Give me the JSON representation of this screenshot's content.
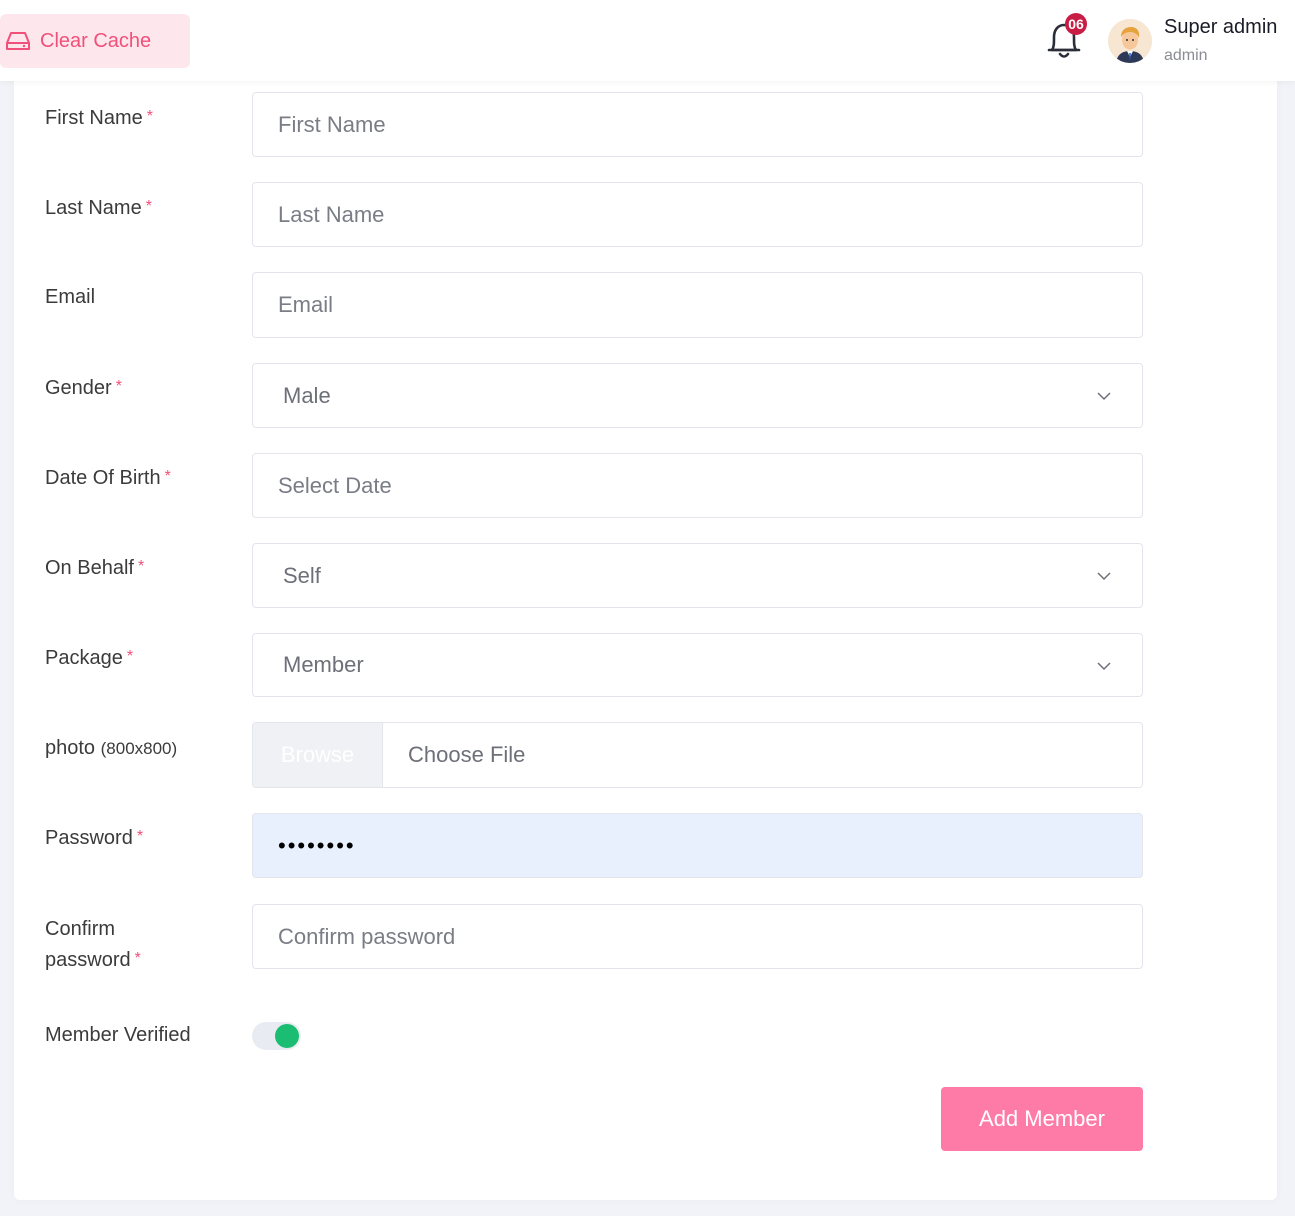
{
  "topbar": {
    "clear_cache_label": "Clear Cache",
    "notification_count": "06",
    "user_name": "Super admin",
    "user_role": "admin"
  },
  "form": {
    "first_name": {
      "label": "First Name",
      "required": "*",
      "placeholder": "First Name"
    },
    "last_name": {
      "label": "Last Name",
      "required": "*",
      "placeholder": "Last Name"
    },
    "email": {
      "label": "Email",
      "placeholder": "Email"
    },
    "gender": {
      "label": "Gender",
      "required": "*",
      "value": "Male"
    },
    "date_of_birth": {
      "label": "Date Of Birth",
      "required": "*",
      "placeholder": "Select Date"
    },
    "on_behalf": {
      "label": "On Behalf",
      "required": "*",
      "value": "Self"
    },
    "package": {
      "label": "Package",
      "required": "*",
      "value": "Member"
    },
    "photo": {
      "label": "photo",
      "hint": "(800x800)",
      "browse_label": "Browse",
      "file_label": "Choose File"
    },
    "password": {
      "label": "Password",
      "required": "*",
      "value": "••••••••"
    },
    "confirm_password": {
      "label_line1": "Confirm",
      "label_line2": "password",
      "required": "*",
      "placeholder": "Confirm password"
    },
    "member_verified": {
      "label": "Member Verified",
      "checked": true
    },
    "submit_label": "Add Member"
  },
  "colors": {
    "accent": "#f0507a",
    "submit_bg": "#fd7ba6",
    "toggle_on": "#1bbd72",
    "badge": "#c81d44"
  }
}
